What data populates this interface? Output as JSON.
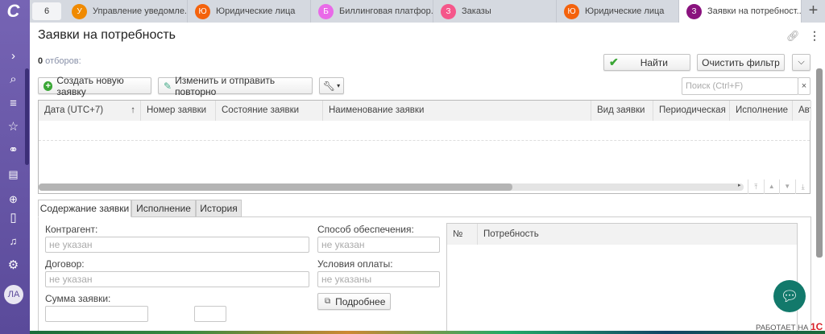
{
  "sidebar": {
    "avatar_initials": "ЛА",
    "icons": [
      "logo-icon",
      "expand-icon",
      "search-icon",
      "menu-icon",
      "star-icon",
      "link-icon",
      "book-icon",
      "chat-plus-icon",
      "phone-icon",
      "bell-icon",
      "gear-icon"
    ]
  },
  "tabs": {
    "count": "6",
    "items": [
      {
        "badge": "У",
        "label": "Управление уведомле...",
        "color": "#f08a00"
      },
      {
        "badge": "Ю",
        "label": "Юридические лица",
        "color": "#f4620c"
      },
      {
        "badge": "Б",
        "label": "Биллинговая платфор...",
        "color": "#e96ae8"
      },
      {
        "badge": "З",
        "label": "Заказы",
        "color": "#f5568a"
      },
      {
        "badge": "Ю",
        "label": "Юридические лица",
        "color": "#f4620c"
      },
      {
        "badge": "З",
        "label": "Заявки на потребност...",
        "color": "#8a127e"
      }
    ],
    "add": "+"
  },
  "page": {
    "title": "Заявки на потребность",
    "filter_count": "0",
    "filter_label": " отборов:"
  },
  "filter": {
    "find": "Найти",
    "clear": "Очистить фильтр"
  },
  "toolbar": {
    "create": "Создать новую заявку",
    "edit_resend": "Изменить и отправить повторно",
    "search_placeholder": "Поиск (Ctrl+F)",
    "search_clear": "×"
  },
  "grid": {
    "columns": [
      "Дата (UTC+7)",
      "Номер заявки",
      "Состояние заявки",
      "Наименование заявки",
      "Вид заявки",
      "Периодическая",
      "Исполнение",
      "Авт"
    ],
    "sort_indicator": "↑"
  },
  "detail_tabs": [
    "Содержание заявки",
    "Исполнение",
    "История"
  ],
  "form": {
    "counterparty_label": "Контрагент:",
    "counterparty_value": "не указан",
    "contract_label": "Договор:",
    "contract_value": "не указан",
    "amount_label": "Сумма заявки:",
    "security_label": "Способ обеспечения:",
    "security_value": "не указан",
    "payment_label": "Условия оплаты:",
    "payment_value": "не указаны",
    "more": "Подробнее"
  },
  "needs_table": {
    "columns": [
      "№",
      "Потребность"
    ]
  },
  "footer": {
    "powered": "РАБОТАЕТ НА",
    "brand": "1С"
  },
  "colors": {
    "sidebar": "#6a5aa8",
    "chat": "#12796b",
    "find_check": "#3aa635"
  }
}
